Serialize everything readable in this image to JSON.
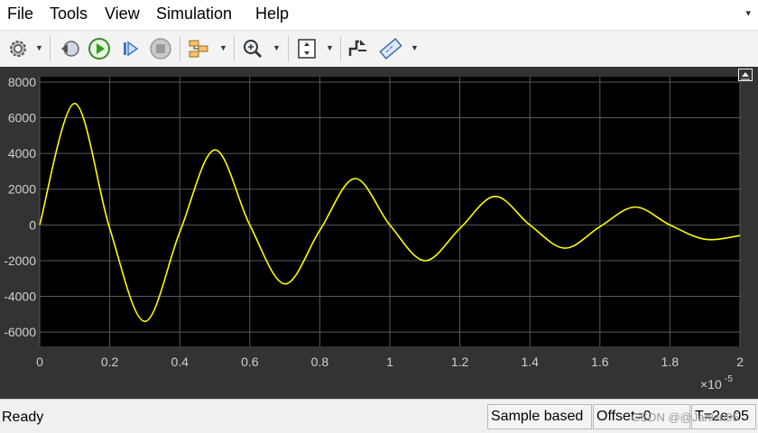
{
  "menu": [
    "File",
    "Tools",
    "View",
    "Simulation",
    "Help"
  ],
  "toolbar_icons": [
    "gear-icon",
    "rewind-icon",
    "run-icon",
    "step-forward-icon",
    "stop-icon",
    "signal-select-icon",
    "zoom-icon",
    "scale-axes-icon",
    "trigger-icon",
    "cursor-measure-icon"
  ],
  "status": {
    "ready": "Ready",
    "sample_mode": "Sample based",
    "offset": "Offset=0",
    "time": "T=2e-05"
  },
  "watermark": "CSDN @@Jankin95",
  "colors": {
    "plot_bg": "#000000",
    "frame_bg": "#333333",
    "trace": "#ffff00",
    "grid": "#5a5a5a",
    "tick_text": "#d0d0d0"
  },
  "chart_data": {
    "type": "line",
    "x_multiplier_label": "×10",
    "x_multiplier_exp": "-5",
    "xlim": [
      0,
      2
    ],
    "ylim": [
      -6800,
      8300
    ],
    "xticks": [
      "0",
      "0.2",
      "0.4",
      "0.6",
      "0.8",
      "1",
      "1.2",
      "1.4",
      "1.6",
      "1.8",
      "2"
    ],
    "yticks": [
      "8000",
      "6000",
      "4000",
      "2000",
      "0",
      "-2000",
      "-4000",
      "-6000"
    ],
    "grid": true,
    "legend": false,
    "series": [
      {
        "description": "damped sinusoid",
        "x": [
          0,
          0.1,
          0.2,
          0.3,
          0.4,
          0.5,
          0.6,
          0.7,
          0.8,
          0.9,
          1.0,
          1.1,
          1.2,
          1.3,
          1.4,
          1.5,
          1.6,
          1.7,
          1.8,
          1.9,
          2.0
        ],
        "y": [
          0,
          6800,
          -200,
          -5400,
          -400,
          4200,
          0,
          -3300,
          -300,
          2600,
          0,
          -2000,
          -200,
          1600,
          0,
          -1300,
          -100,
          1000,
          0,
          -800,
          -600
        ]
      }
    ]
  }
}
